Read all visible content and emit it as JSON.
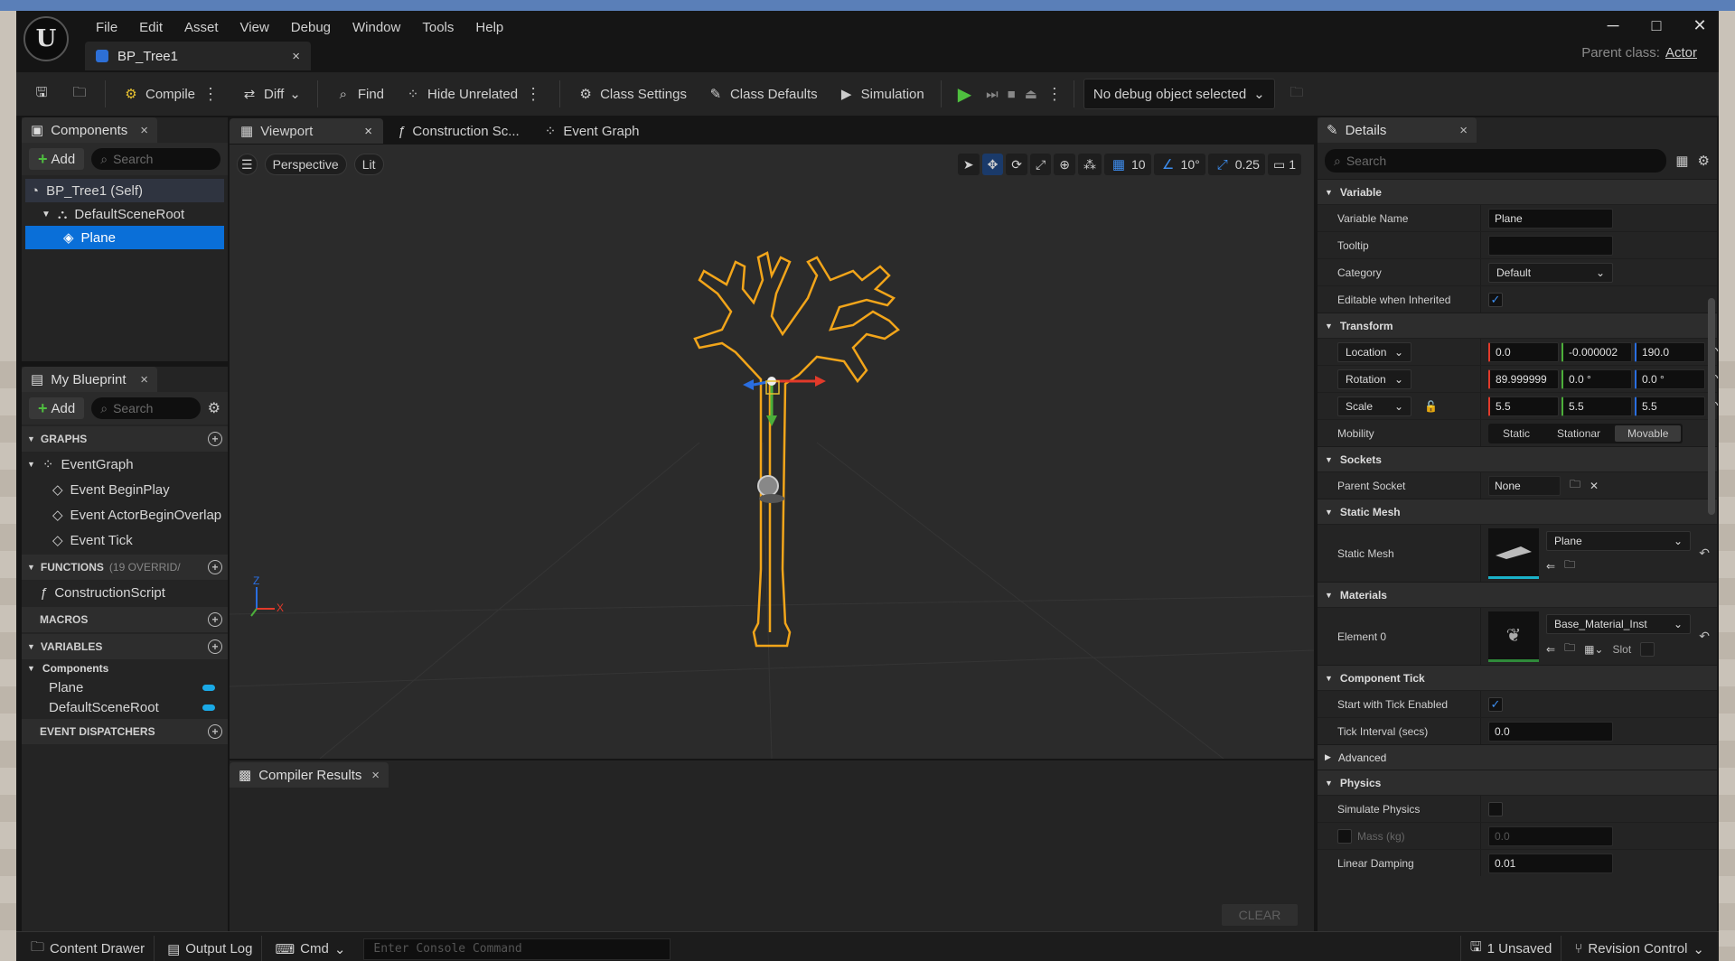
{
  "menu": [
    "File",
    "Edit",
    "Asset",
    "View",
    "Debug",
    "Window",
    "Tools",
    "Help"
  ],
  "document_tab": {
    "title": "BP_Tree1",
    "close": "×"
  },
  "window_controls": {
    "minimize": "─",
    "maximize": "□",
    "close": "✕"
  },
  "parent_class": {
    "label": "Parent class:",
    "value": "Actor"
  },
  "toolbar": {
    "compile": "Compile",
    "diff": "Diff",
    "find": "Find",
    "hide_unrelated": "Hide Unrelated",
    "class_settings": "Class Settings",
    "class_defaults": "Class Defaults",
    "simulation": "Simulation",
    "debug_object": "No debug object selected"
  },
  "components_panel": {
    "title": "Components",
    "add": "Add",
    "search_placeholder": "Search",
    "tree": [
      {
        "label": "BP_Tree1 (Self)"
      },
      {
        "label": "DefaultSceneRoot"
      },
      {
        "label": "Plane",
        "selected": true
      }
    ]
  },
  "my_blueprint": {
    "title": "My Blueprint",
    "add": "Add",
    "search_placeholder": "Search",
    "graphs_header": "GRAPHS",
    "graphs": [
      "EventGraph",
      "Event BeginPlay",
      "Event ActorBeginOverlap",
      "Event Tick"
    ],
    "functions_header": "FUNCTIONS",
    "functions_note": "(19 OVERRID/",
    "functions": [
      "ConstructionScript"
    ],
    "macros_header": "MACROS",
    "variables_header": "VARIABLES",
    "variables_group": "Components",
    "variables": [
      "Plane",
      "DefaultSceneRoot"
    ],
    "dispatchers_header": "EVENT DISPATCHERS"
  },
  "editor_tabs": [
    {
      "label": "Viewport",
      "active": true
    },
    {
      "label": "Construction Sc...",
      "active": false
    },
    {
      "label": "Event Graph",
      "active": false
    }
  ],
  "viewport": {
    "perspective": "Perspective",
    "lit": "Lit",
    "grid_snap": "10",
    "rot_snap": "10°",
    "scale_snap": "0.25",
    "camera_speed": "1",
    "axis_x": "X",
    "axis_z": "Z"
  },
  "compiler": {
    "title": "Compiler Results",
    "clear": "CLEAR"
  },
  "details": {
    "title": "Details",
    "search_placeholder": "Search",
    "sections": {
      "variable": "Variable",
      "transform": "Transform",
      "sockets": "Sockets",
      "static_mesh": "Static Mesh",
      "materials": "Materials",
      "component_tick": "Component Tick",
      "advanced": "Advanced",
      "physics": "Physics"
    },
    "variable_name": {
      "label": "Variable Name",
      "value": "Plane"
    },
    "tooltip": {
      "label": "Tooltip",
      "value": ""
    },
    "category": {
      "label": "Category",
      "value": "Default"
    },
    "editable": {
      "label": "Editable when Inherited",
      "checked": true
    },
    "location": {
      "label": "Location",
      "x": "0.0",
      "y": "-0.000002",
      "z": "190.0"
    },
    "rotation": {
      "label": "Rotation",
      "x": "89.999999",
      "y": "0.0 °",
      "z": "0.0 °"
    },
    "scale": {
      "label": "Scale",
      "x": "5.5",
      "y": "5.5",
      "z": "5.5"
    },
    "mobility": {
      "label": "Mobility",
      "options": [
        "Static",
        "Stationar",
        "Movable"
      ],
      "selected": "Movable"
    },
    "parent_socket": {
      "label": "Parent Socket",
      "value": "None"
    },
    "static_mesh_row": {
      "label": "Static Mesh",
      "value": "Plane"
    },
    "element0": {
      "label": "Element 0",
      "value": "Base_Material_Inst",
      "slot": "Slot"
    },
    "tick_enabled": {
      "label": "Start with Tick Enabled",
      "checked": true
    },
    "tick_interval": {
      "label": "Tick Interval (secs)",
      "value": "0.0"
    },
    "simulate_physics": {
      "label": "Simulate Physics",
      "checked": false
    },
    "mass": {
      "label": "Mass (kg)",
      "value": "0.0"
    },
    "linear_damping": {
      "label": "Linear Damping",
      "value": "0.01"
    }
  },
  "status_bar": {
    "content_drawer": "Content Drawer",
    "output_log": "Output Log",
    "cmd": "Cmd",
    "console_placeholder": "Enter Console Command",
    "unsaved": "1 Unsaved",
    "revision": "Revision Control"
  },
  "colors": {
    "accent": "#0a6fd8",
    "tree_outline": "#f2a51a",
    "play": "#4fbf3f",
    "pill": "#1aa9e6"
  }
}
